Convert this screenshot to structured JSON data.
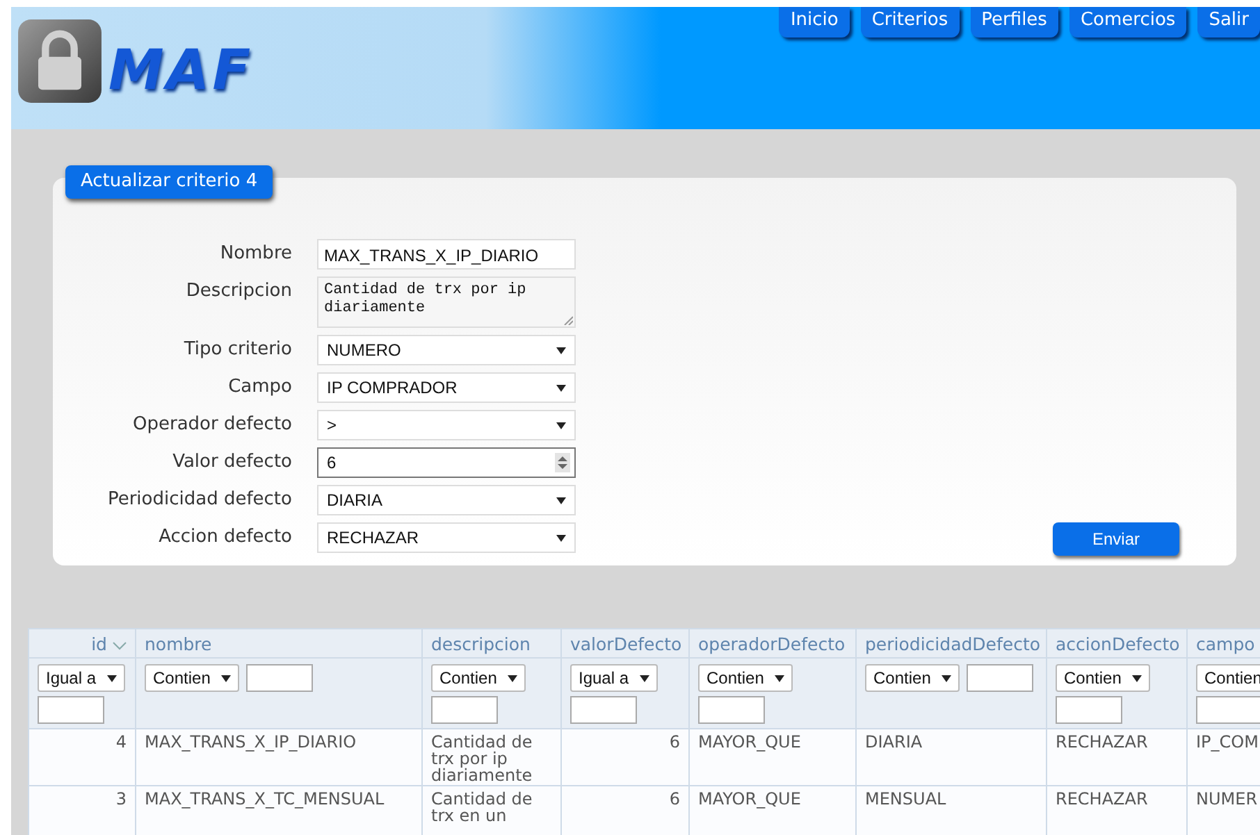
{
  "header": {
    "logo_text": "MAF",
    "nav": [
      {
        "label": "Inicio"
      },
      {
        "label": "Criterios"
      },
      {
        "label": "Perfiles"
      },
      {
        "label": "Comercios"
      },
      {
        "label": "Salir"
      }
    ]
  },
  "form": {
    "tab": "Actualizar criterio 4",
    "fields": [
      {
        "label": "Nombre",
        "kind": "text",
        "value": "MAX_TRANS_X_IP_DIARIO"
      },
      {
        "label": "Descripcion",
        "kind": "textarea",
        "value": "Cantidad de trx por ip diariamente"
      },
      {
        "label": "Tipo criterio",
        "kind": "select",
        "value": "NUMERO"
      },
      {
        "label": "Campo",
        "kind": "select",
        "value": "IP COMPRADOR"
      },
      {
        "label": "Operador defecto",
        "kind": "select",
        "value": ">"
      },
      {
        "label": "Valor defecto",
        "kind": "number",
        "value": "6",
        "focused": true
      },
      {
        "label": "Periodicidad defecto",
        "kind": "select",
        "value": "DIARIA"
      },
      {
        "label": "Accion defecto",
        "kind": "select",
        "value": "RECHAZAR"
      }
    ],
    "submit": "Enviar"
  },
  "table": {
    "columns": [
      {
        "title": "id",
        "kind": "number",
        "sorted": true,
        "filter": {
          "operator": "Igual a",
          "kind": "below"
        }
      },
      {
        "title": "nombre",
        "kind": "text",
        "sorted": false,
        "filter": {
          "operator": "Contien",
          "kind": "inline"
        }
      },
      {
        "title": "descripcion",
        "kind": "text",
        "sorted": false,
        "filter": {
          "operator": "Contien",
          "kind": "below"
        }
      },
      {
        "title": "valorDefecto",
        "kind": "number",
        "sorted": false,
        "filter": {
          "operator": "Igual a",
          "kind": "below"
        }
      },
      {
        "title": "operadorDefecto",
        "kind": "text",
        "sorted": false,
        "filter": {
          "operator": "Contien",
          "kind": "below"
        }
      },
      {
        "title": "periodicidadDefecto",
        "kind": "text",
        "sorted": false,
        "filter": {
          "operator": "Contien",
          "kind": "inline"
        }
      },
      {
        "title": "accionDefecto",
        "kind": "text",
        "sorted": false,
        "filter": {
          "operator": "Contien",
          "kind": "below"
        }
      },
      {
        "title": "campo",
        "kind": "text",
        "sorted": false,
        "filter": {
          "operator": "Contien",
          "kind": "below"
        }
      }
    ],
    "rows": [
      [
        "4",
        "MAX_TRANS_X_IP_DIARIO",
        "Cantidad de trx por ip diariamente",
        "6",
        "MAYOR_QUE",
        "DIARIA",
        "RECHAZAR",
        "IP_COM"
      ],
      [
        "3",
        "MAX_TRANS_X_TC_MENSUAL",
        "Cantidad de trx en un",
        "6",
        "MAYOR_QUE",
        "MENSUAL",
        "RECHAZAR",
        "NUMER"
      ]
    ]
  }
}
